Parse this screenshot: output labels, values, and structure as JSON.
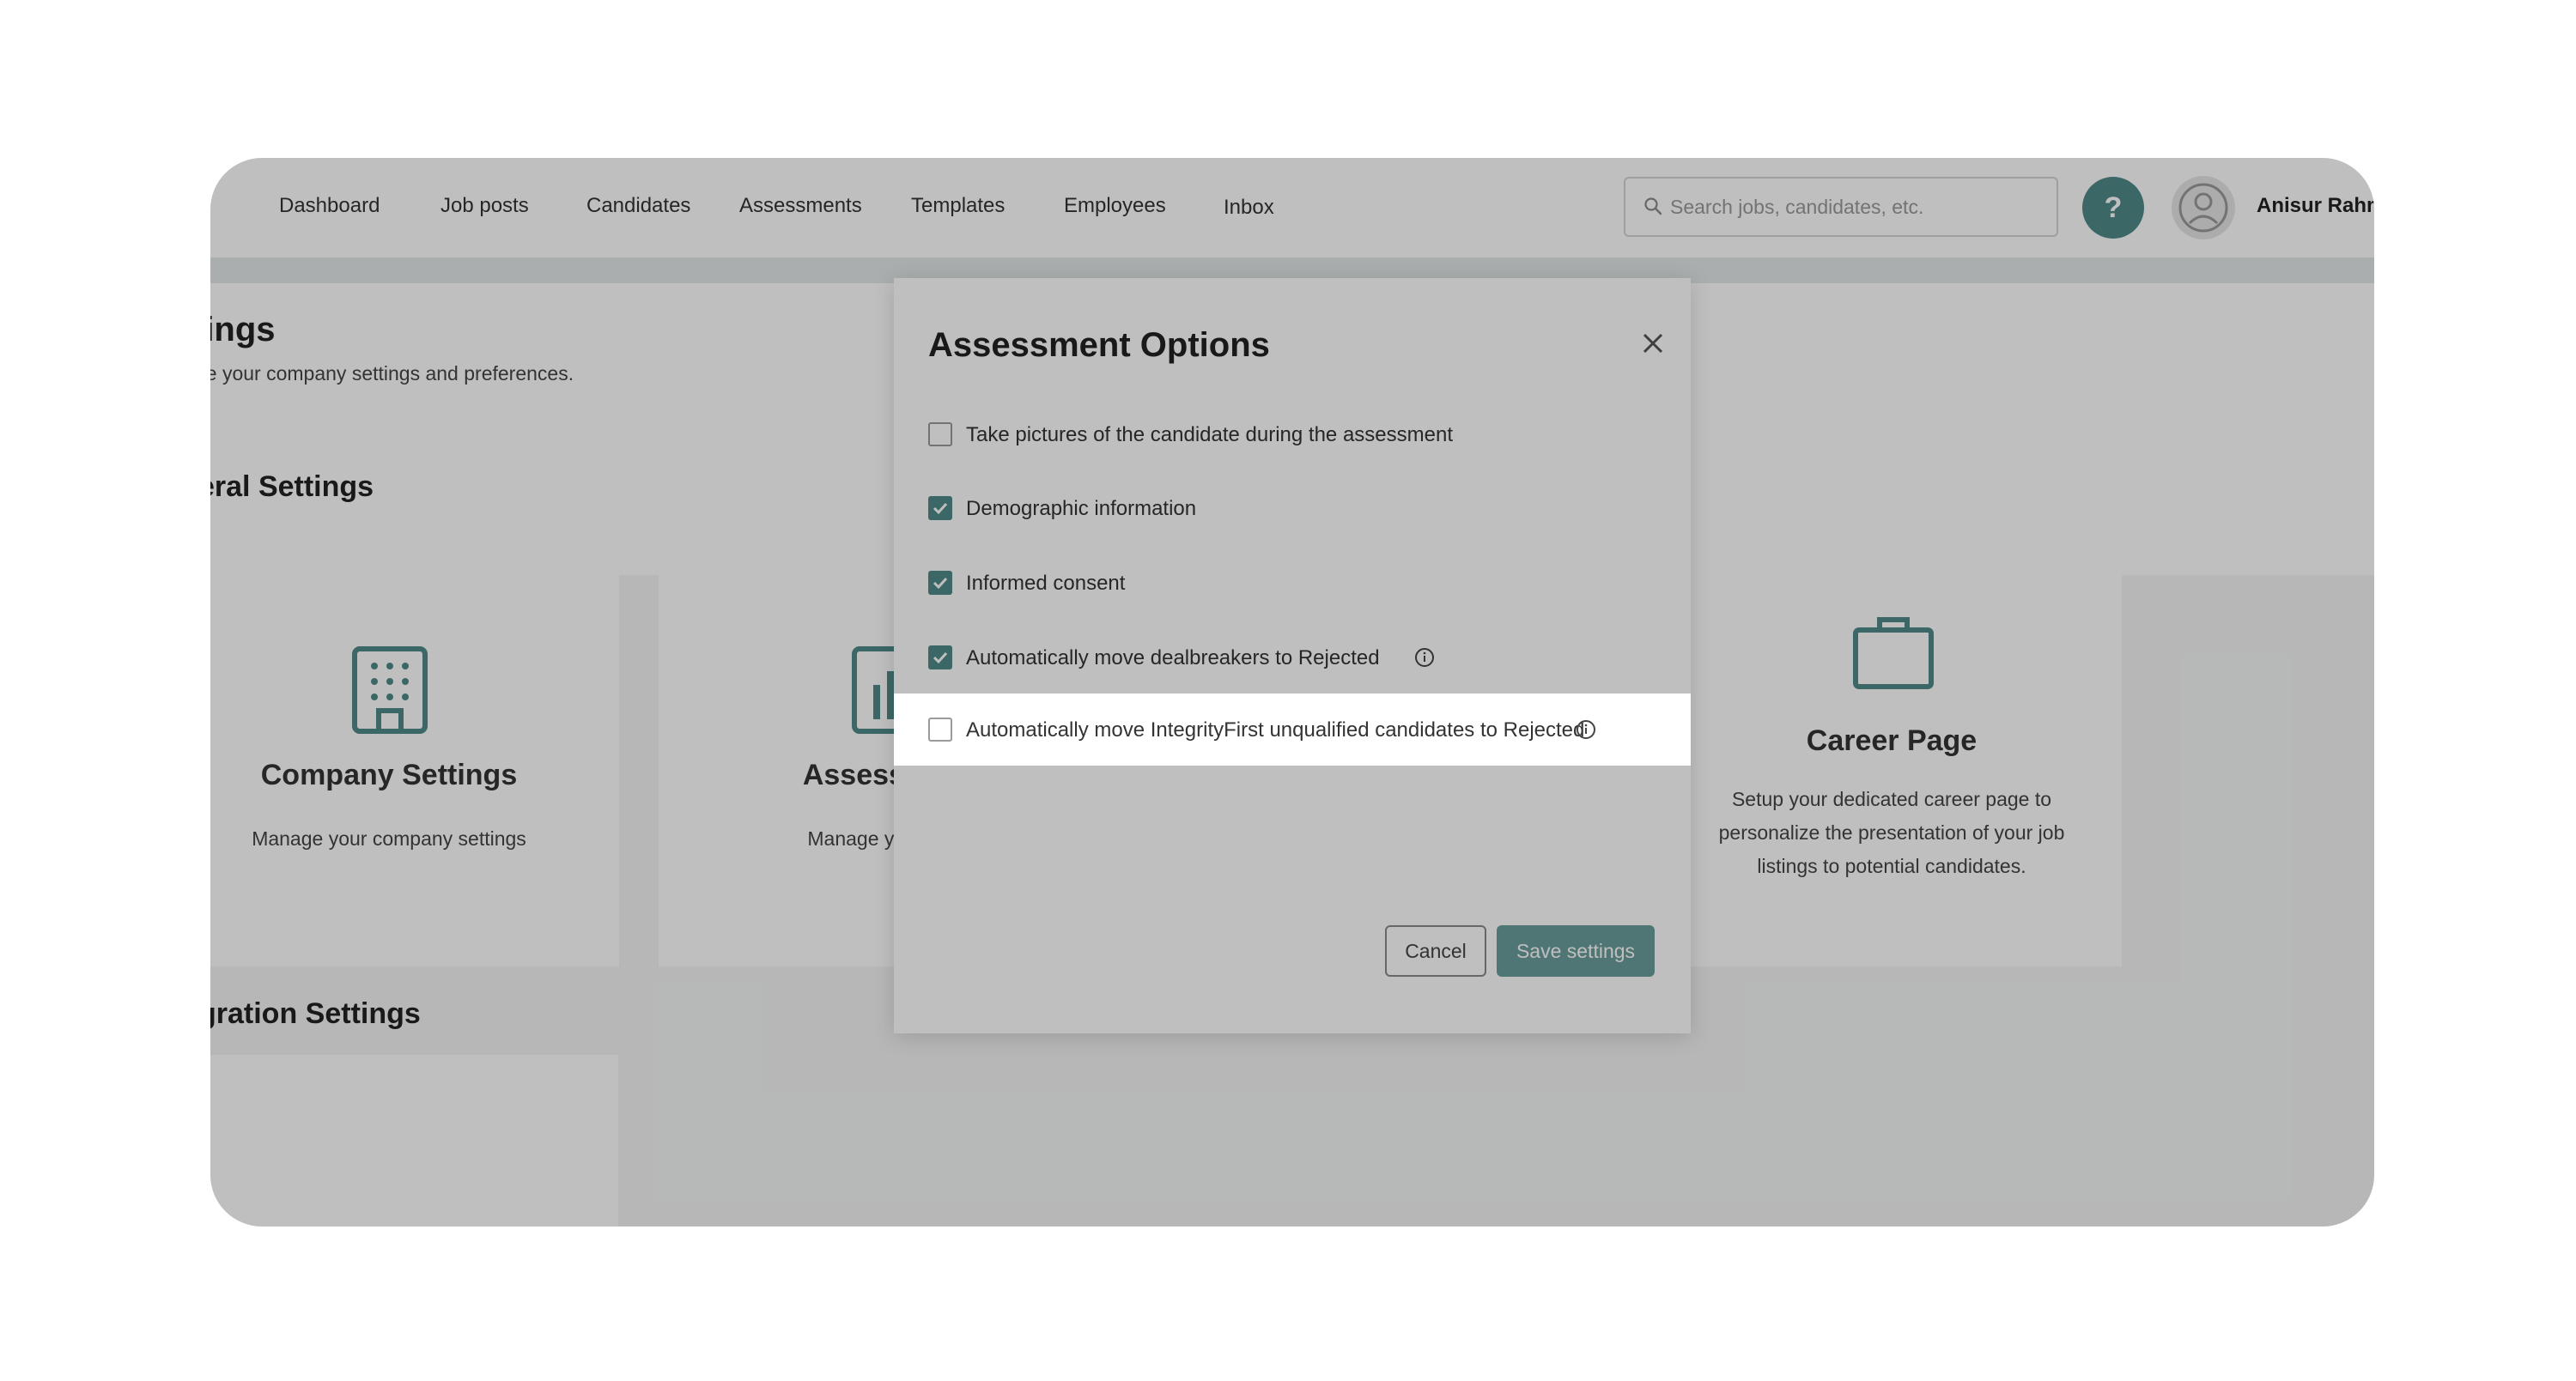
{
  "nav": {
    "items": [
      "Dashboard",
      "Job posts",
      "Candidates",
      "Assessments",
      "Templates",
      "Employees",
      "Inbox"
    ],
    "search_placeholder": "Search jobs, candidates, etc.",
    "help_label": "?",
    "user_name": "Anisur Rahm"
  },
  "page": {
    "title": "tings",
    "subtitle": "ge your company settings and preferences.",
    "general_section": "eral Settings",
    "integration_section": "gration Settings"
  },
  "cards": {
    "company": {
      "title": "Company Settings",
      "desc": "Manage your company settings"
    },
    "assessment": {
      "title": "Assessment",
      "desc": "Manage your asse"
    },
    "career": {
      "title": "Career Page",
      "desc": "Setup your dedicated career page to personalize the presentation of your job listings to potential candidates."
    }
  },
  "modal": {
    "title": "Assessment Options",
    "options": [
      {
        "label": "Take pictures of the candidate during the assessment",
        "checked": false
      },
      {
        "label": "Demographic information",
        "checked": true
      },
      {
        "label": "Informed consent",
        "checked": true
      },
      {
        "label": "Automatically move dealbreakers to Rejected",
        "checked": true
      },
      {
        "label": "Automatically move IntegrityFirst unqualified candidates to Rejected",
        "checked": false
      }
    ],
    "cancel_label": "Cancel",
    "save_label": "Save settings"
  },
  "colors": {
    "accent": "#4f8a88",
    "save_button": "#6a9e9c",
    "overlay": "rgba(0,0,0,0.25)"
  }
}
